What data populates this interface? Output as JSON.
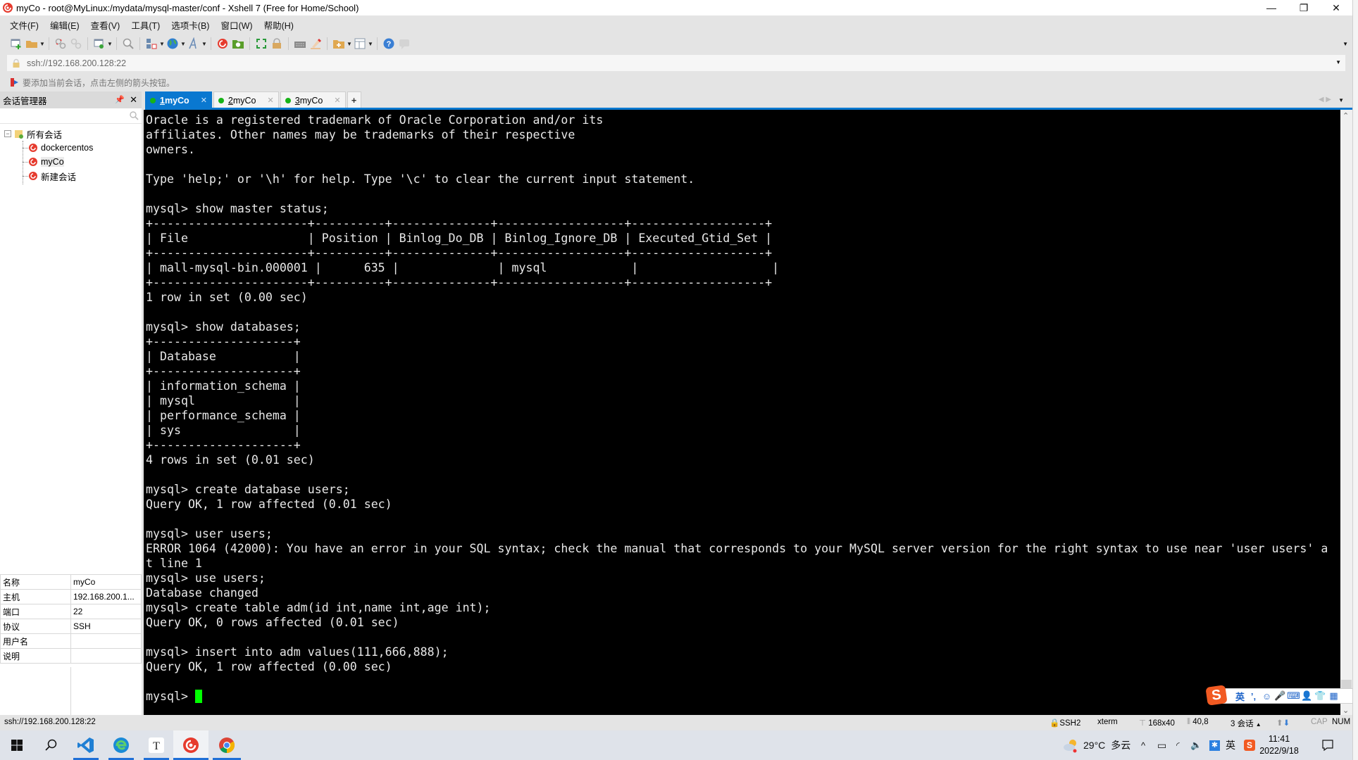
{
  "window": {
    "title": "myCo - root@MyLinux:/mydata/mysql-master/conf - Xshell 7 (Free for Home/School)",
    "minimize_label": "—",
    "maximize_label": "❐",
    "close_label": "✕"
  },
  "menu": [
    "文件(F)",
    "编辑(E)",
    "查看(V)",
    "工具(T)",
    "选项卡(B)",
    "窗口(W)",
    "帮助(H)"
  ],
  "toolbar": {
    "icons": [
      "new-session-icon",
      "open-folder-icon",
      "disconnect-icon",
      "reconnect-icon",
      "session-properties-icon",
      "find-icon",
      "transfer-icon",
      "globe-icon",
      "font-icon",
      "xshell-icon",
      "xftp-icon",
      "fullscreen-icon",
      "lock-icon",
      "keyboard-icon",
      "highlight-icon",
      "new-tab-group-icon",
      "layout-icon",
      "help-icon",
      "chat-icon"
    ]
  },
  "address": {
    "value": "ssh://192.168.200.128:22"
  },
  "hint": {
    "text": "要添加当前会话，点击左侧的箭头按钮。"
  },
  "session_manager": {
    "title": "会话管理器",
    "pin_label": "ᵖ",
    "close_label": "✕",
    "search_placeholder": "",
    "root": "所有会话",
    "root_expander": "−",
    "sessions": [
      {
        "label": "dockercentos",
        "selected": false
      },
      {
        "label": "myCo",
        "selected": true
      },
      {
        "label": "新建会话",
        "selected": false
      }
    ]
  },
  "properties": [
    {
      "key": "名称",
      "value": "myCo"
    },
    {
      "key": "主机",
      "value": "192.168.200.1..."
    },
    {
      "key": "端口",
      "value": "22"
    },
    {
      "key": "协议",
      "value": "SSH"
    },
    {
      "key": "用户名",
      "value": ""
    },
    {
      "key": "说明",
      "value": ""
    }
  ],
  "tabs": [
    {
      "num": "1",
      "label": " myCo",
      "active": true
    },
    {
      "num": "2",
      "label": " myCo",
      "active": false
    },
    {
      "num": "3",
      "label": " myCo",
      "active": false
    }
  ],
  "tab_add_label": "+",
  "tab_nav": "◀ ▶",
  "terminal": {
    "lines": [
      "Oracle is a registered trademark of Oracle Corporation and/or its",
      "affiliates. Other names may be trademarks of their respective",
      "owners.",
      "",
      "Type 'help;' or '\\h' for help. Type '\\c' to clear the current input statement.",
      "",
      "mysql> show master status;",
      "+----------------------+----------+--------------+------------------+-------------------+",
      "| File                 | Position | Binlog_Do_DB | Binlog_Ignore_DB | Executed_Gtid_Set |",
      "+----------------------+----------+--------------+------------------+-------------------+",
      "| mall-mysql-bin.000001 |      635 |              | mysql            |                   |",
      "+----------------------+----------+--------------+------------------+-------------------+",
      "1 row in set (0.00 sec)",
      "",
      "mysql> show databases;",
      "+--------------------+",
      "| Database           |",
      "+--------------------+",
      "| information_schema |",
      "| mysql              |",
      "| performance_schema |",
      "| sys                |",
      "+--------------------+",
      "4 rows in set (0.01 sec)",
      "",
      "mysql> create database users;",
      "Query OK, 1 row affected (0.01 sec)",
      "",
      "mysql> user users;",
      "ERROR 1064 (42000): You have an error in your SQL syntax; check the manual that corresponds to your MySQL server version for the right syntax to use near 'user users' a",
      "t line 1",
      "mysql> use users;",
      "Database changed",
      "mysql> create table adm(id int,name int,age int);",
      "Query OK, 0 rows affected (0.01 sec)",
      "",
      "mysql> insert into adm values(111,666,888);",
      "Query OK, 1 row affected (0.00 sec)",
      ""
    ],
    "prompt": "mysql> ",
    "cursor_color": "#00ff00"
  },
  "ime": {
    "logo": "S",
    "items": [
      "英",
      "’,",
      "☺",
      "🎤",
      "⌨",
      "👤",
      "👕",
      "▦"
    ]
  },
  "statusbar": {
    "address": "ssh://192.168.200.128:22",
    "protocol": "SSH2",
    "terminal_type": "xterm",
    "size": "168x40",
    "cursor_pos": "40,8",
    "sessions": "3 会话",
    "cap": "CAP",
    "num": "NUM"
  },
  "taskbar": {
    "apps": [
      "start",
      "search",
      "vscode",
      "edge",
      "typora",
      "xshell",
      "chrome"
    ],
    "weather_temp": "29°C",
    "weather_desc": "多云",
    "tray_chevron": "^",
    "ime_label": "英",
    "time": "11:41",
    "date": "2022/9/18"
  },
  "colors": {
    "accent": "#0a78d0",
    "terminal_bg": "#000000",
    "terminal_fg": "#e8e8e8",
    "session_dot": "#17b317"
  }
}
